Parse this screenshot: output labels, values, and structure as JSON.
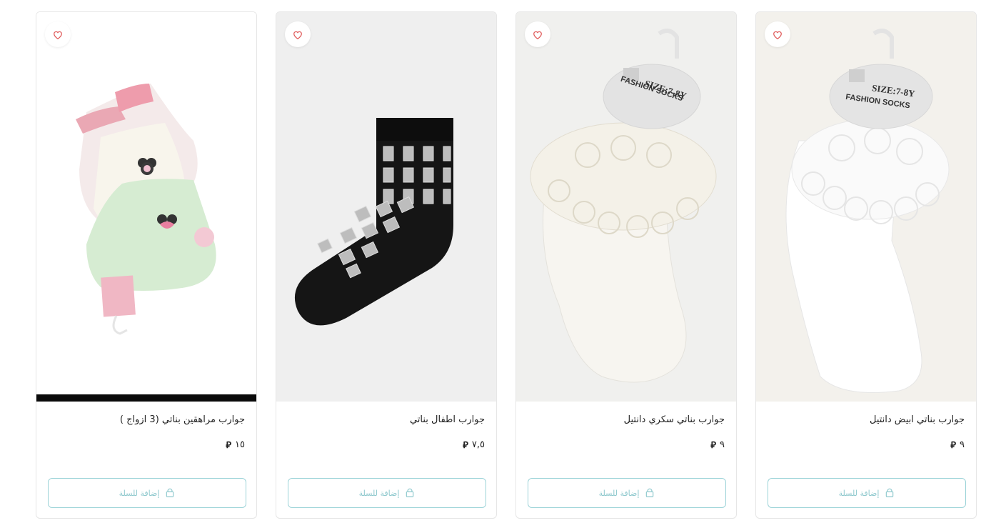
{
  "products": [
    {
      "title": "جوارب بناتي ابيض دانتيل",
      "price": "٩",
      "currency": "ر.س",
      "cart_label": "إضافة للسلة",
      "image_icon": "white-lace-sock-image",
      "card_header_text": "SIZE:7-8Y",
      "card_header_text2": "FASHION SOCKS"
    },
    {
      "title": "جوارب بناتي سكري دانتيل",
      "price": "٩",
      "currency": "ر.س",
      "cart_label": "إضافة للسلة",
      "image_icon": "cream-lace-sock-image",
      "card_header_text": "SIZE:7-8Y",
      "card_header_text2": "FASHION SOCKS"
    },
    {
      "title": "جوارب اطفال بناتي",
      "price": "٧,٥",
      "currency": "ر.س",
      "cart_label": "إضافة للسلة",
      "image_icon": "black-grid-sock-image"
    },
    {
      "title": "جوارب مراهقين بناتي (3 ازواج )",
      "price": "١٥",
      "currency": "ر.س",
      "cart_label": "إضافة للسلة",
      "image_icon": "pastel-socks-pack-image"
    }
  ],
  "colors": {
    "button_border": "#9cd3d8",
    "button_text": "#8fc9ce",
    "heart": "#e05b5b"
  }
}
